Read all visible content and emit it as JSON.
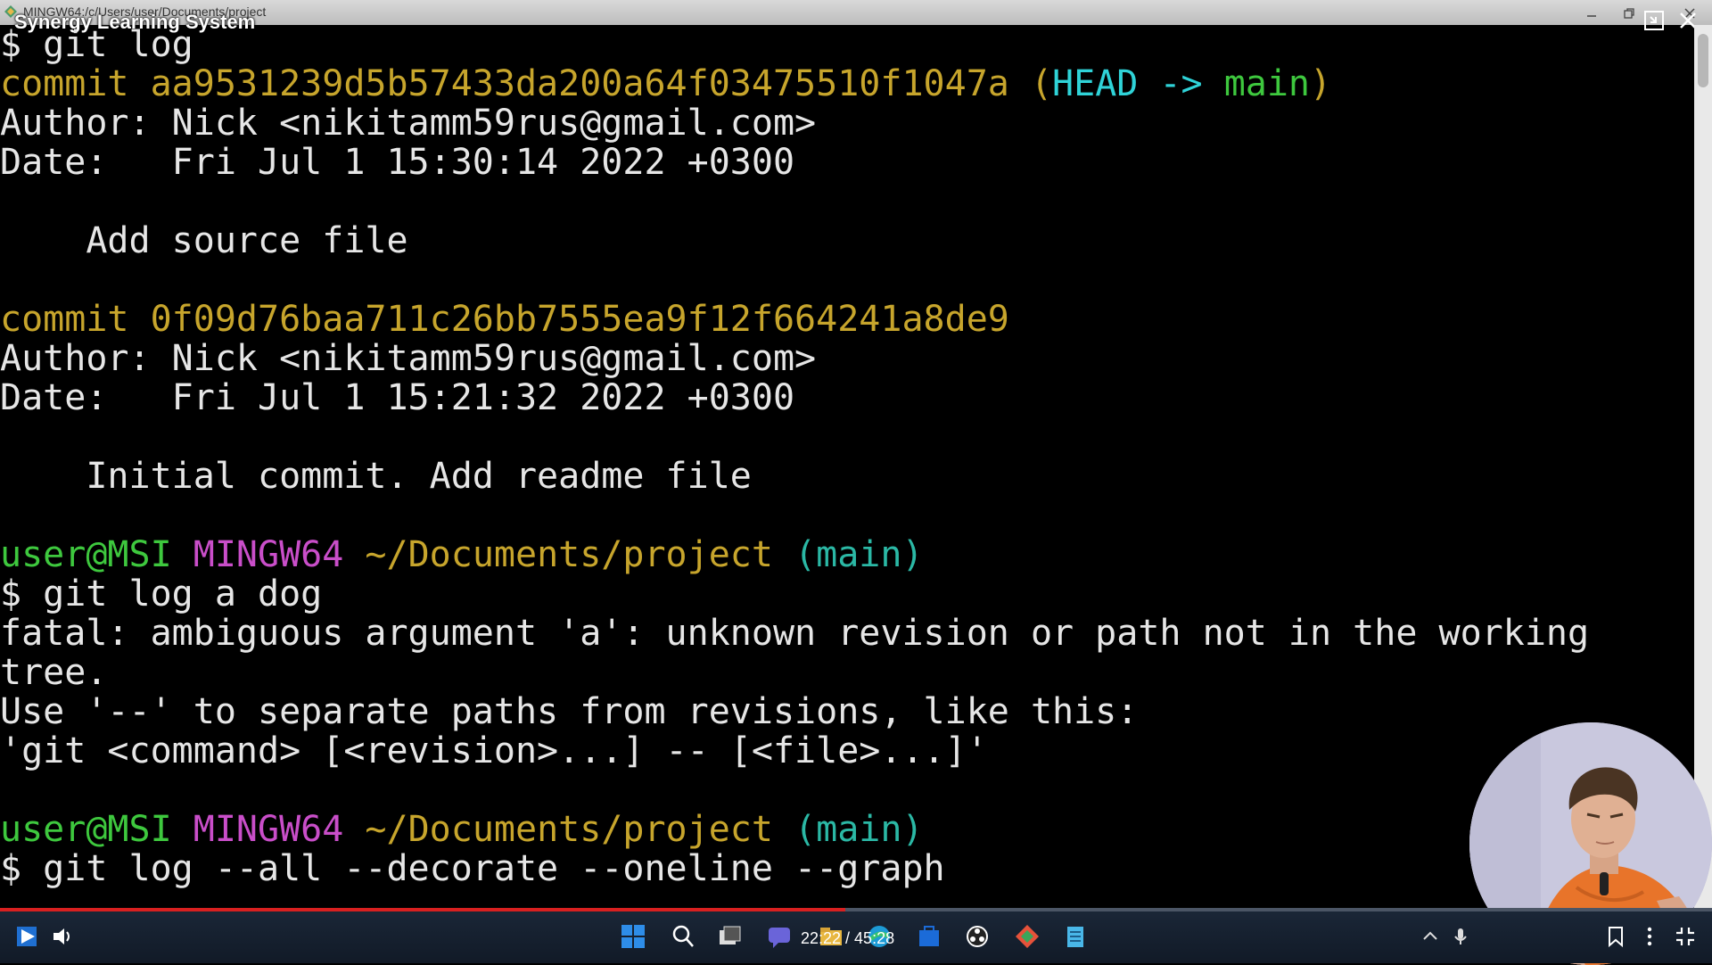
{
  "window": {
    "path_title": "MINGW64:/c/Users/user/Documents/project",
    "overlay_title": "Synergy Learning System"
  },
  "terminal": {
    "lines": [
      {
        "segments": [
          {
            "t": "$ git log",
            "c": "white"
          }
        ]
      },
      {
        "segments": [
          {
            "t": "commit aa9531239d5b57433da200a64f03475510f1047a ",
            "c": "yellow"
          },
          {
            "t": "(",
            "c": "yellow"
          },
          {
            "t": "HEAD -> ",
            "c": "cyan"
          },
          {
            "t": "main",
            "c": "green"
          },
          {
            "t": ")",
            "c": "yellow"
          }
        ]
      },
      {
        "segments": [
          {
            "t": "Author: Nick <nikitamm59rus@gmail.com>",
            "c": "white"
          }
        ]
      },
      {
        "segments": [
          {
            "t": "Date:   Fri Jul 1 15:30:14 2022 +0300",
            "c": "white"
          }
        ]
      },
      {
        "segments": [
          {
            "t": "",
            "c": "white"
          }
        ]
      },
      {
        "segments": [
          {
            "t": "    Add source file",
            "c": "white"
          }
        ]
      },
      {
        "segments": [
          {
            "t": "",
            "c": "white"
          }
        ]
      },
      {
        "segments": [
          {
            "t": "commit 0f09d76baa711c26bb7555ea9f12f664241a8de9",
            "c": "yellow"
          }
        ]
      },
      {
        "segments": [
          {
            "t": "Author: Nick <nikitamm59rus@gmail.com>",
            "c": "white"
          }
        ]
      },
      {
        "segments": [
          {
            "t": "Date:   Fri Jul 1 15:21:32 2022 +0300",
            "c": "white"
          }
        ]
      },
      {
        "segments": [
          {
            "t": "",
            "c": "white"
          }
        ]
      },
      {
        "segments": [
          {
            "t": "    Initial commit. Add readme file",
            "c": "white"
          }
        ]
      },
      {
        "segments": [
          {
            "t": "",
            "c": "white"
          }
        ]
      },
      {
        "segments": [
          {
            "t": "user@MSI ",
            "c": "green"
          },
          {
            "t": "MINGW64 ",
            "c": "magenta"
          },
          {
            "t": "~/Documents/project ",
            "c": "yellow"
          },
          {
            "t": "(main)",
            "c": "teal"
          }
        ]
      },
      {
        "segments": [
          {
            "t": "$ git log a dog",
            "c": "white"
          }
        ]
      },
      {
        "segments": [
          {
            "t": "fatal: ambiguous argument 'a': unknown revision or path not in the working",
            "c": "white"
          }
        ]
      },
      {
        "segments": [
          {
            "t": "tree.",
            "c": "white"
          }
        ]
      },
      {
        "segments": [
          {
            "t": "Use '--' to separate paths from revisions, like this:",
            "c": "white"
          }
        ]
      },
      {
        "segments": [
          {
            "t": "'git <command> [<revision>...] -- [<file>...]'",
            "c": "white"
          }
        ]
      },
      {
        "segments": [
          {
            "t": "",
            "c": "white"
          }
        ]
      },
      {
        "segments": [
          {
            "t": "user@MSI ",
            "c": "green"
          },
          {
            "t": "MINGW64 ",
            "c": "magenta"
          },
          {
            "t": "~/Documents/project ",
            "c": "yellow"
          },
          {
            "t": "(main)",
            "c": "teal"
          }
        ]
      },
      {
        "segments": [
          {
            "t": "$ git log --all --decorate --oneline --graph",
            "c": "white"
          }
        ]
      }
    ]
  },
  "player": {
    "current_time": "22:22",
    "total_time": "45:28",
    "timecode": "22:22 / 45:28",
    "progress_fraction": 0.494
  },
  "colors": {
    "accent_progress": "#d92020",
    "terminal_bg": "#000000"
  },
  "icons": [
    "play-icon",
    "volume-icon",
    "windows-start-icon",
    "search-icon",
    "task-view-icon",
    "chat-icon",
    "file-explorer-icon",
    "edge-icon",
    "store-icon",
    "obs-icon",
    "git-icon",
    "notepad-icon",
    "tray-chevron-icon",
    "mic-icon",
    "bookmark-icon",
    "more-icon",
    "exit-fullscreen-icon"
  ]
}
